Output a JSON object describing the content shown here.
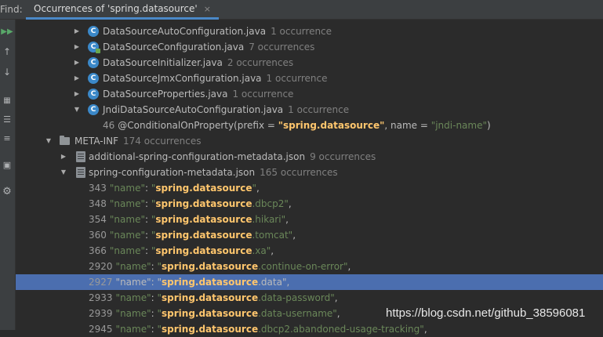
{
  "window": {
    "find_label": "Find:",
    "tab_title": "Occurrences of 'spring.datasource'",
    "tab_close": "×"
  },
  "sidebar": {
    "icons": [
      "rerun-icon",
      "previous-occurrence-icon",
      "next-occurrence-icon",
      "group-icon",
      "expand-all-icon",
      "collapse-all-icon",
      "preview-icon",
      "settings-icon"
    ]
  },
  "tree": {
    "classes": [
      {
        "name": "DataSourceAutoConfiguration.java",
        "count": "1 occurrence"
      },
      {
        "name": "DataSourceConfiguration.java",
        "count": "7 occurrences"
      },
      {
        "name": "DataSourceInitializer.java",
        "count": "2 occurrences"
      },
      {
        "name": "DataSourceJmxConfiguration.java",
        "count": "1 occurrence"
      },
      {
        "name": "DataSourceProperties.java",
        "count": "1 occurrence"
      },
      {
        "name": "JndiDataSourceAutoConfiguration.java",
        "count": "1 occurrence"
      }
    ],
    "jndi_line": {
      "line": "46",
      "prefix": "@ConditionalOnProperty(prefix = ",
      "value": "\"spring.datasource\"",
      "mid": ", name = ",
      "name_value": "\"jndi-name\"",
      "end": ")"
    },
    "meta_inf": {
      "name": "META-INF",
      "count": "174 occurrences"
    },
    "json_files": [
      {
        "name": "additional-spring-configuration-metadata.json",
        "count": "9 occurrences"
      },
      {
        "name": "spring-configuration-metadata.json",
        "count": "165 occurrences"
      }
    ],
    "matches": [
      {
        "line": "343",
        "suffix": "",
        "selected": false
      },
      {
        "line": "348",
        "suffix": ".dbcp2",
        "selected": false
      },
      {
        "line": "354",
        "suffix": ".hikari",
        "selected": false
      },
      {
        "line": "360",
        "suffix": ".tomcat",
        "selected": false
      },
      {
        "line": "366",
        "suffix": ".xa",
        "selected": false
      },
      {
        "line": "2920",
        "suffix": ".continue-on-error",
        "selected": false
      },
      {
        "line": "2927",
        "suffix": ".data",
        "selected": true
      },
      {
        "line": "2933",
        "suffix": ".data-password",
        "selected": false
      },
      {
        "line": "2939",
        "suffix": ".data-username",
        "selected": false
      },
      {
        "line": "2945",
        "suffix": ".dbcp2.abandoned-usage-tracking",
        "selected": false
      }
    ],
    "match_key": "\"name\"",
    "match_sep": ": ",
    "match_prefix": "spring.datasource",
    "match_comma": ","
  },
  "watermark": "https://blog.csdn.net/github_38596081",
  "colors": {
    "background": "#2b2b2b",
    "selection": "#4b6eaf",
    "highlight": "#ffc66d",
    "string": "#6a8759",
    "key": "#9876aa"
  }
}
